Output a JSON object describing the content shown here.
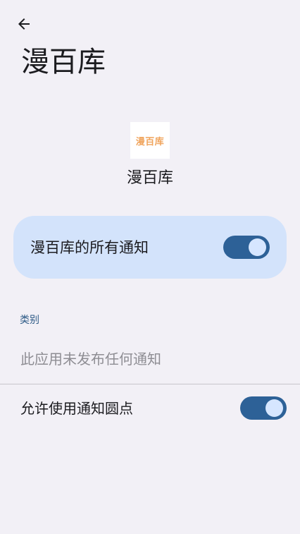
{
  "header": {
    "back_icon": "arrow-back-icon",
    "title": "漫百库"
  },
  "app": {
    "logo_text": "漫百库",
    "logo_color": "#f0a45c",
    "name": "漫百库"
  },
  "all_notifications": {
    "label": "漫百库的所有通知",
    "enabled": true
  },
  "categories": {
    "header": "类别",
    "empty_message": "此应用未发布任何通知"
  },
  "notification_dots": {
    "label": "允许使用通知圆点",
    "enabled": true
  },
  "colors": {
    "background": "#f2f0f6",
    "card": "#d3e3fb",
    "toggle_track": "#2d6197",
    "toggle_knob": "#d6e6ff",
    "section_header": "#2d5a86"
  }
}
